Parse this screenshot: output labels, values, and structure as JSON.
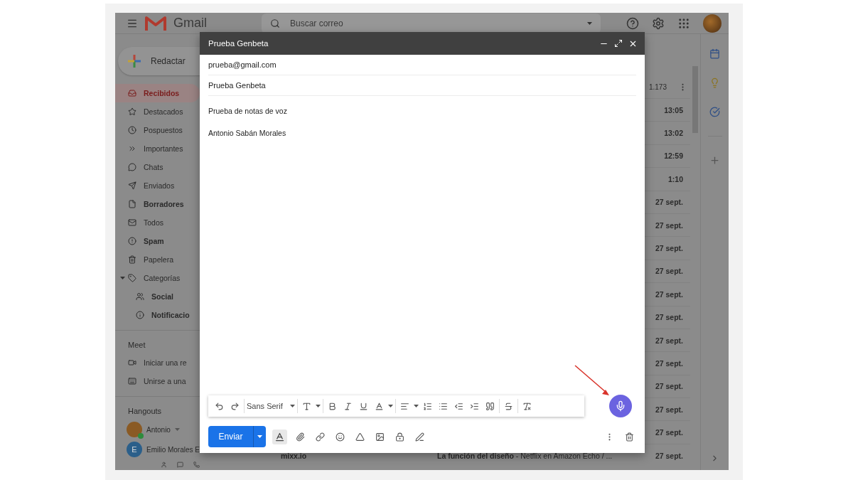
{
  "topbar": {
    "app_name": "Gmail",
    "search": {
      "placeholder": "Buscar correo"
    }
  },
  "sidebar": {
    "compose_label": "Redactar",
    "items": [
      {
        "label": "Recibidos",
        "selected": true,
        "unread": true
      },
      {
        "label": "Destacados",
        "selected": false,
        "unread": false
      },
      {
        "label": "Pospuestos",
        "selected": false,
        "unread": false
      },
      {
        "label": "Importantes",
        "selected": false,
        "unread": false
      },
      {
        "label": "Chats",
        "selected": false,
        "unread": false
      },
      {
        "label": "Enviados",
        "selected": false,
        "unread": false
      },
      {
        "label": "Borradores",
        "selected": false,
        "unread": true
      },
      {
        "label": "Todos",
        "selected": false,
        "unread": false
      },
      {
        "label": "Spam",
        "selected": false,
        "unread": true
      },
      {
        "label": "Papelera",
        "selected": false,
        "unread": false
      },
      {
        "label": "Categorías",
        "selected": false,
        "unread": false,
        "expanded": true,
        "children": [
          {
            "label": "Social",
            "selected": false,
            "unread": true
          },
          {
            "label": "Notificacio",
            "selected": false,
            "unread": true
          }
        ]
      }
    ],
    "meet": {
      "title": "Meet",
      "items": [
        "Iniciar una re",
        "Unirse a una"
      ]
    },
    "hangouts": {
      "title": "Hangouts",
      "user": {
        "name": "Antonio",
        "online": true
      },
      "contacts": [
        {
          "name": "Emilio Morales E",
          "initial": "E"
        }
      ]
    }
  },
  "mail_list": {
    "count": "1.173",
    "rows": [
      {
        "time": "13:05"
      },
      {
        "time": "13:02"
      },
      {
        "time": "12:59"
      },
      {
        "time": "1:10"
      },
      {
        "time": "27 sept."
      },
      {
        "time": "27 sept."
      },
      {
        "time": "27 sept."
      },
      {
        "time": "27 sept."
      },
      {
        "time": "27 sept."
      },
      {
        "time": "27 sept."
      },
      {
        "time": "27 sept."
      },
      {
        "time": "27 sept."
      },
      {
        "time": "27 sept."
      },
      {
        "time": "27 sept."
      },
      {
        "time": "27 sept."
      },
      {
        "sender": "mixx.io",
        "subject": "La función del diseño",
        "snippet": "- Netflix en Amazon Echo / ...",
        "time": "27 sept."
      }
    ]
  },
  "compose": {
    "title": "Prueba Genbeta",
    "to": "prueba@gmail.com",
    "subject": "Prueba Genbeta",
    "body": [
      "Prueba de notas de voz",
      "Antonio Sabán Morales"
    ],
    "font": "Sans Serif",
    "send_label": "Enviar"
  }
}
